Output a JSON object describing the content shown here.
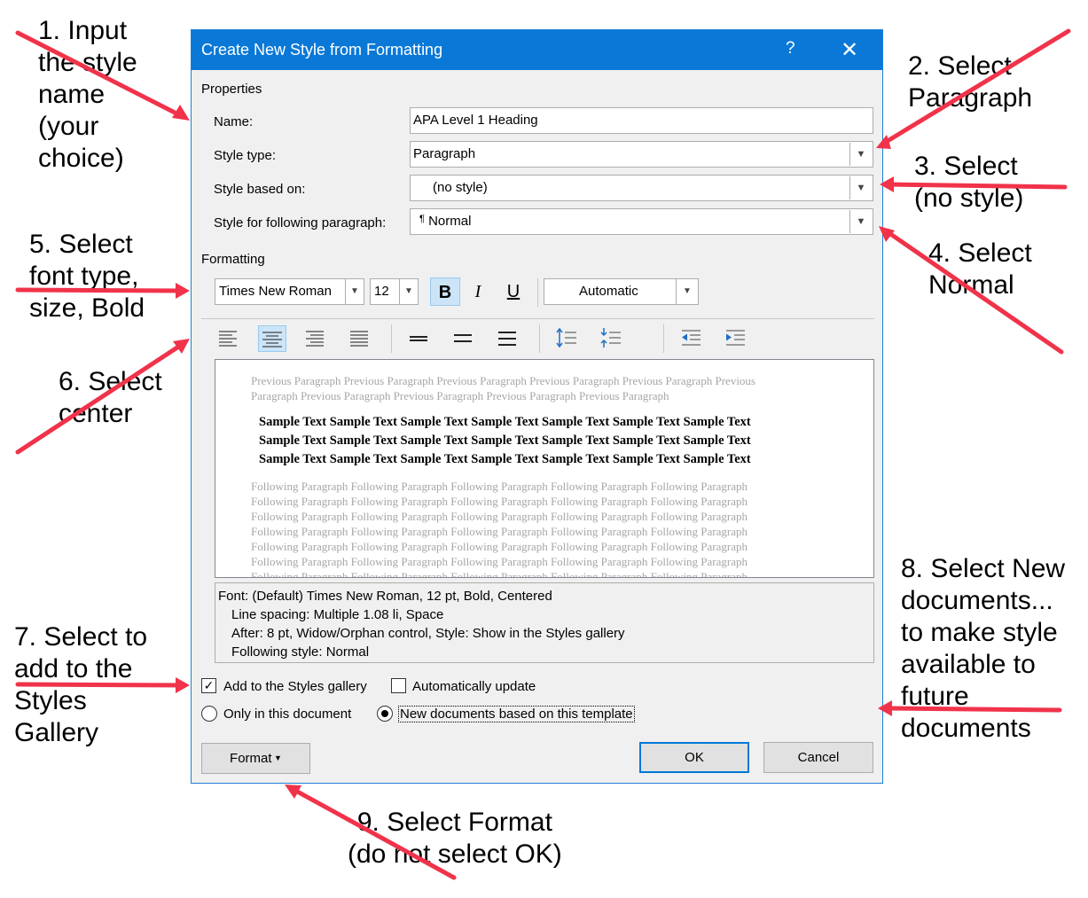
{
  "annotations": {
    "step1": "1. Input\nthe style\nname\n(your\nchoice)",
    "step2": "2. Select\nParagraph",
    "step3": "3. Select\n(no style)",
    "step4": "4. Select\nNormal",
    "step5": "5. Select\nfont type,\nsize, Bold",
    "step6": "6. Select\ncenter",
    "step7": "7. Select to\nadd to the\nStyles\nGallery",
    "step8": "8. Select New\ndocuments...\nto make style\navailable to\nfuture\ndocuments",
    "step9": "9. Select Format\n(do not select OK)"
  },
  "dialog": {
    "title": "Create New Style from Formatting",
    "help": "?",
    "close": "✕",
    "properties_label": "Properties",
    "name_label": "Name:",
    "name_value": "APA Level 1 Heading",
    "style_type_label": "Style type:",
    "style_type_value": "Paragraph",
    "based_on_label": "Style based on:",
    "based_on_value": "(no style)",
    "following_label": "Style for following paragraph:",
    "following_value": "Normal",
    "formatting_label": "Formatting",
    "font_value": "Times New Roman",
    "size_value": "12",
    "bold_label": "B",
    "italic_label": "I",
    "underline_label": "U",
    "color_value": "Automatic",
    "preview": {
      "previous_1": "Previous Paragraph Previous Paragraph Previous Paragraph Previous Paragraph Previous Paragraph Previous",
      "previous_2": "Paragraph Previous Paragraph Previous Paragraph Previous Paragraph Previous Paragraph",
      "sample_1": "Sample Text Sample Text Sample Text Sample Text Sample Text Sample Text Sample Text",
      "sample_2": "Sample Text Sample Text Sample Text Sample Text Sample Text Sample Text Sample Text",
      "sample_3": "Sample Text Sample Text Sample Text Sample Text Sample Text Sample Text Sample Text",
      "following_1": "Following Paragraph Following Paragraph Following Paragraph Following Paragraph Following Paragraph",
      "following_2": "Following Paragraph Following Paragraph Following Paragraph Following Paragraph Following Paragraph",
      "following_3": "Following Paragraph Following Paragraph Following Paragraph Following Paragraph Following Paragraph",
      "following_4": "Following Paragraph Following Paragraph Following Paragraph Following Paragraph Following Paragraph",
      "following_5": "Following Paragraph Following Paragraph Following Paragraph Following Paragraph Following Paragraph",
      "following_6": "Following Paragraph Following Paragraph Following Paragraph Following Paragraph Following Paragraph",
      "following_7": "Following Paragraph Following Paragraph Following Paragraph Following Paragraph Following Paragraph"
    },
    "description": {
      "line1": "Font: (Default) Times New Roman, 12 pt, Bold, Centered",
      "line2": "Line spacing:  Multiple 1.08 li, Space",
      "line3": "After:  8 pt, Widow/Orphan control, Style: Show in the Styles gallery",
      "line4": "Following style: Normal"
    },
    "add_to_gallery_label": "Add to the Styles gallery",
    "add_to_gallery_checked": true,
    "auto_update_label": "Automatically update",
    "auto_update_checked": false,
    "only_this_doc_label": "Only in this document",
    "new_docs_label": "New documents based on this template",
    "selected_scope": "New documents based on this template",
    "format_button": "Format",
    "ok_button": "OK",
    "cancel_button": "Cancel"
  },
  "colors": {
    "titlebar": "#0a78d7",
    "arrow": "#f0334a",
    "toggle_on": "#cce4f7"
  }
}
